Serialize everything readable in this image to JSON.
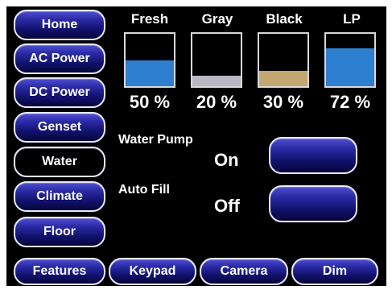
{
  "sidebar": {
    "items": [
      {
        "label": "Home",
        "active": false
      },
      {
        "label": "AC Power",
        "active": false
      },
      {
        "label": "DC Power",
        "active": false
      },
      {
        "label": "Genset",
        "active": false
      },
      {
        "label": "Water",
        "active": true
      },
      {
        "label": "Climate",
        "active": false
      },
      {
        "label": "Floor",
        "active": false
      }
    ]
  },
  "bottom_bar": {
    "features": "Features",
    "keypad": "Keypad",
    "camera": "Camera",
    "dim": "Dim"
  },
  "tanks": [
    {
      "label": "Fresh",
      "percent_text": "50 %",
      "level": 0.5,
      "fill_color": "#2f7fd0"
    },
    {
      "label": "Gray",
      "percent_text": "20 %",
      "level": 0.2,
      "fill_color": "#b8b8c4"
    },
    {
      "label": "Black",
      "percent_text": "30 %",
      "level": 0.3,
      "fill_color": "#c2a870"
    },
    {
      "label": "LP",
      "percent_text": "72 %",
      "level": 0.72,
      "fill_color": "#2f7fd0"
    }
  ],
  "controls": {
    "water_pump": {
      "label": "Water Pump",
      "state": "On"
    },
    "auto_fill": {
      "label": "Auto Fill",
      "state": "Off"
    }
  },
  "colors": {
    "button_gradient_top": "#4f4fd0",
    "button_gradient_bottom": "#05053a",
    "button_border": "#e8e8ff",
    "screen_background": "#000000"
  }
}
